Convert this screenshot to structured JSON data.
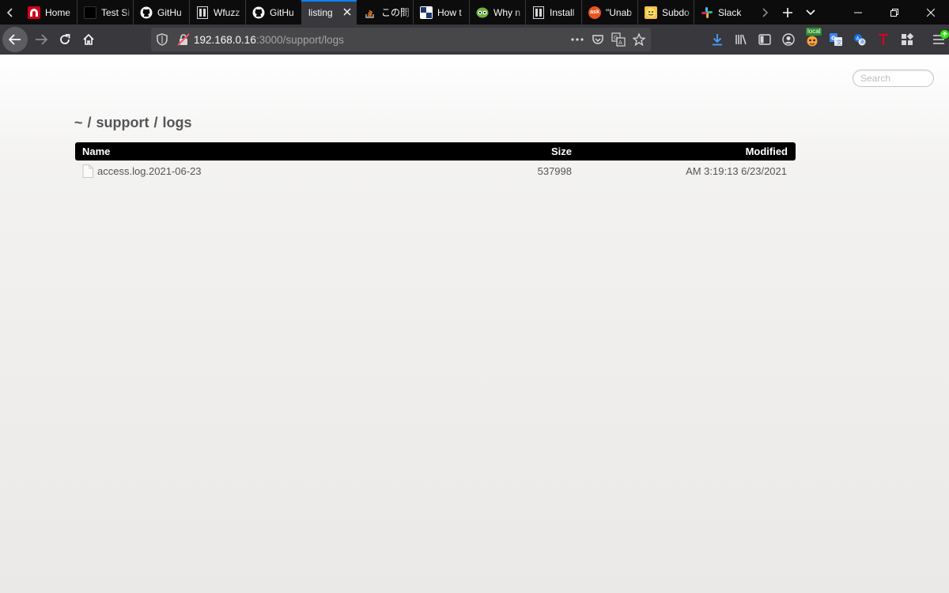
{
  "browser": {
    "tabs": [
      {
        "label": "Home",
        "icon": "red-arch-icon",
        "active": false
      },
      {
        "label": "Test Si",
        "icon": "dark-square-icon",
        "active": false
      },
      {
        "label": "GitHu",
        "icon": "github-icon",
        "active": false
      },
      {
        "label": "Wfuzz",
        "icon": "doc-icon",
        "active": false
      },
      {
        "label": "GitHu",
        "icon": "github-icon",
        "active": false
      },
      {
        "label": "listing",
        "icon": "",
        "active": true
      },
      {
        "label": "この問",
        "icon": "stackoverflow-icon",
        "active": false
      },
      {
        "label": "How t",
        "icon": "checker-icon",
        "active": false
      },
      {
        "label": "Why n",
        "icon": "owl-icon",
        "active": false
      },
      {
        "label": "Install",
        "icon": "doc-icon",
        "active": false
      },
      {
        "label": "\"Unab",
        "icon": "askubuntu-icon",
        "active": false
      },
      {
        "label": "Subdo",
        "icon": "emoji-icon",
        "active": false
      },
      {
        "label": "Slack",
        "icon": "slack-icon",
        "active": false
      }
    ],
    "url_host": "192.168.0.16",
    "url_rest": ":3000/support/logs",
    "extension_badge": "local",
    "colors": {
      "tab_accent": "#0a84ff",
      "toolbar": "#38383d",
      "urlbar": "#474749",
      "download_arrow": "#45a1ff"
    }
  },
  "page": {
    "search_placeholder": "Search",
    "breadcrumb": [
      "~",
      "support",
      "logs"
    ],
    "breadcrumb_separator": "/",
    "table": {
      "headers": {
        "name": "Name",
        "size": "Size",
        "modified": "Modified"
      },
      "rows": [
        {
          "name": "access.log.2021-06-23",
          "size": "537998",
          "modified": "AM 3:19:13 6/23/2021"
        }
      ]
    }
  }
}
